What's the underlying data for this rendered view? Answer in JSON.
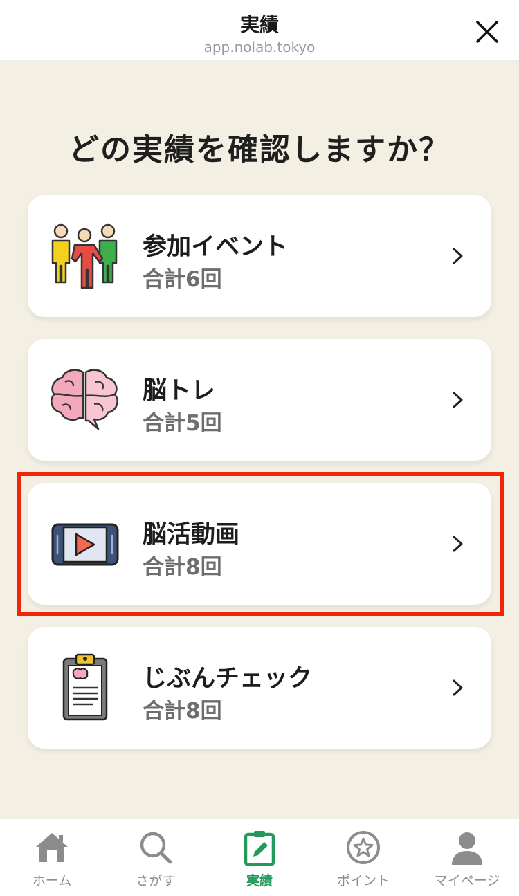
{
  "header": {
    "title": "実績",
    "url": "app.nolab.tokyo",
    "close_icon": "close-icon"
  },
  "main": {
    "heading": "どの実績を確認しますか？",
    "cards": [
      {
        "label": "参加イベント",
        "count": "合計6回",
        "icon": "people-icon"
      },
      {
        "label": "脳トレ",
        "count": "合計5回",
        "icon": "brain-puzzle-icon"
      },
      {
        "label": "脳活動画",
        "count": "合計8回",
        "icon": "video-play-icon"
      },
      {
        "label": "じぶんチェック",
        "count": "合計8回",
        "icon": "clipboard-icon"
      }
    ],
    "highlight_color": "#f0250a"
  },
  "tabbar": {
    "active_color": "#23995c",
    "inactive_color": "#8c8c8c",
    "tabs": [
      {
        "label": "ホーム",
        "icon": "home-icon"
      },
      {
        "label": "さがす",
        "icon": "search-icon"
      },
      {
        "label": "実績",
        "icon": "clipboard-edit-icon",
        "active": true
      },
      {
        "label": "ポイント",
        "icon": "star-circle-icon"
      },
      {
        "label": "マイページ",
        "icon": "user-icon"
      }
    ]
  }
}
